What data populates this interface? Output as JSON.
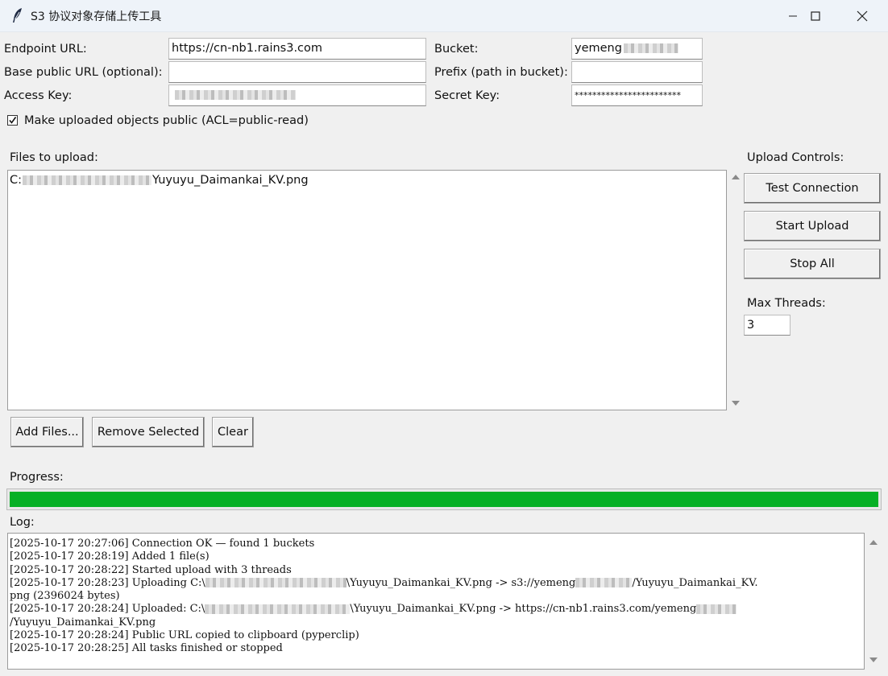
{
  "window": {
    "title": "S3 协议对象存储上传工具",
    "app_icon": "feather-icon",
    "controls": [
      "minimize-icon",
      "maximize-icon",
      "close-icon"
    ]
  },
  "config": {
    "endpoint_label": "Endpoint URL:",
    "endpoint_value": "https://cn-nb1.rains3.com",
    "bucket_label": "Bucket:",
    "bucket_value": "yemeng",
    "base_url_label": "Base public URL (optional):",
    "base_url_value": "",
    "prefix_label": "Prefix (path in bucket):",
    "prefix_value": "",
    "access_key_label": "Access Key:",
    "access_key_value": "",
    "secret_key_label": "Secret Key:",
    "secret_key_value": "************************",
    "public_checkbox_label": "Make uploaded objects public (ACL=public-read)",
    "public_checked": true
  },
  "files": {
    "label": "Files to upload:",
    "items": [
      {
        "prefix": "C:",
        "name": "Yuyuyu_Daimankai_KV.png"
      }
    ],
    "add_button": "Add Files...",
    "remove_button": "Remove Selected",
    "clear_button": "Clear"
  },
  "controls": {
    "label": "Upload Controls:",
    "test_button": "Test Connection",
    "start_button": "Start Upload",
    "stop_button": "Stop All",
    "threads_label": "Max Threads:",
    "threads_value": "3"
  },
  "progress": {
    "label": "Progress:",
    "percent": 100,
    "color": "#06b025"
  },
  "log": {
    "label": "Log:",
    "lines": [
      "[2025-10-17 20:27:06] Connection OK — found 1 buckets",
      "[2025-10-17 20:28:19] Added 1 file(s)",
      "[2025-10-17 20:28:22] Started upload with 3 threads",
      "[2025-10-17 20:28:23] Uploading C:\\",
      "\\Yuyuyu_Daimankai_KV.png -> s3://yemeng",
      "/Yuyuyu_Daimankai_KV.",
      "png (2396024 bytes)",
      "[2025-10-17 20:28:24] Uploaded: C:\\",
      "\\Yuyuyu_Daimankai_KV.png -> https://cn-nb1.rains3.com/yemeng",
      "/Yuyuyu_Daimankai_KV.png",
      "[2025-10-17 20:28:24] Public URL copied to clipboard (pyperclip)",
      "[2025-10-17 20:28:25] All tasks finished or stopped"
    ]
  }
}
